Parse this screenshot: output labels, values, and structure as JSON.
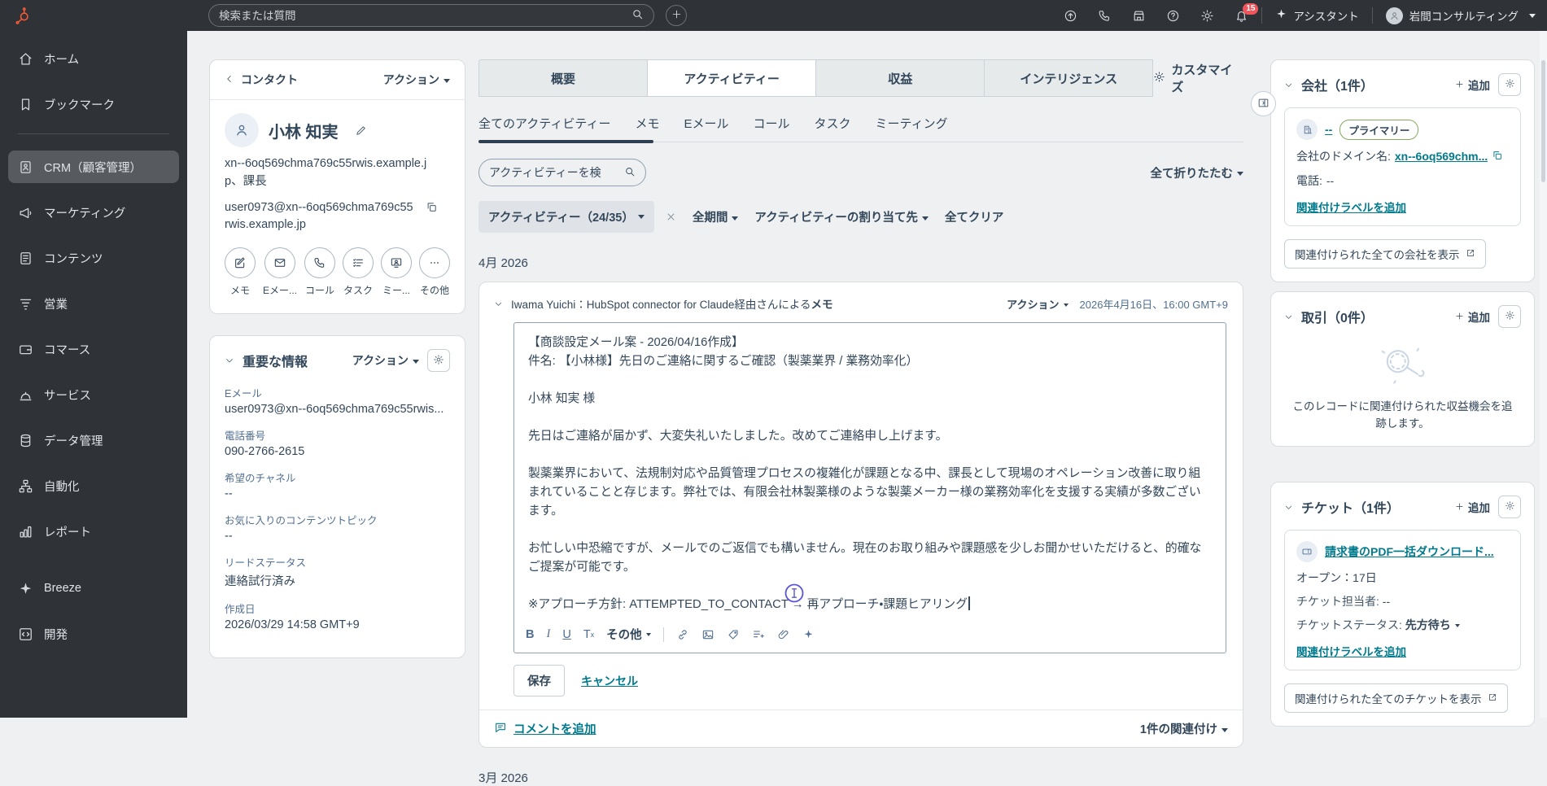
{
  "topbar": {
    "search_placeholder": "検索または質問",
    "assistant_label": "アシスタント",
    "account_name": "岩間コンサルティング",
    "notification_count": "15"
  },
  "sidebar": {
    "items": [
      {
        "label": "ホーム"
      },
      {
        "label": "ブックマーク"
      },
      {
        "label": "CRM（顧客管理）"
      },
      {
        "label": "マーケティング"
      },
      {
        "label": "コンテンツ"
      },
      {
        "label": "営業"
      },
      {
        "label": "コマース"
      },
      {
        "label": "サービス"
      },
      {
        "label": "データ管理"
      },
      {
        "label": "自動化"
      },
      {
        "label": "レポート"
      },
      {
        "label": "Breeze"
      },
      {
        "label": "開発"
      }
    ]
  },
  "contact": {
    "back_label": "コンタクト",
    "actions_label": "アクション",
    "name": "小林 知実",
    "title_line": "xn--6oq569chma769c55rwis.example.jp、課長",
    "email_line": "user0973@xn--6oq569chma769c55rwis.example.jp",
    "quick_actions": [
      "メモ",
      "Eメー...",
      "コール",
      "タスク",
      "ミー...",
      "その他"
    ],
    "about": {
      "title": "重要な情報",
      "actions_label": "アクション",
      "fields": [
        {
          "label": "Eメール",
          "value": "user0973@xn--6oq569chma769c55rwis..."
        },
        {
          "label": "電話番号",
          "value": "090-2766-2615"
        },
        {
          "label": "希望のチャネル",
          "value": "--"
        },
        {
          "label": "お気に入りのコンテンツトピック",
          "value": "--"
        },
        {
          "label": "リードステータス",
          "value": "連絡試行済み"
        },
        {
          "label": "作成日",
          "value": "2026/03/29 14:58 GMT+9"
        }
      ]
    }
  },
  "main": {
    "tabs": [
      "概要",
      "アクティビティー",
      "収益",
      "インテリジェンス"
    ],
    "customize_label": "カスタマイズ",
    "subtabs": [
      "全てのアクティビティー",
      "メモ",
      "Eメール",
      "コール",
      "タスク",
      "ミーティング"
    ],
    "search_placeholder": "アクティビティーを検",
    "collapse_all": "全て折りたたむ",
    "filter_chip": "アクティビティー（24/35）",
    "filter_period": "全期間",
    "filter_assignee": "アクティビティーの割り当て先",
    "clear_all": "全てクリア",
    "month_heading": "4月 2026",
    "next_month_heading": "3月 2026",
    "note": {
      "title": "Iwama Yuichi：HubSpot connector for Claude経由さんによる",
      "title_bold": "メモ",
      "actions_label": "アクション",
      "timestamp": "2026年4月16日、16:00 GMT+9",
      "paragraphs": [
        "【商談設定メール案 - 2026/04/16作成】",
        "件名: 【小林様】先日のご連絡に関するご確認（製薬業界 / 業務効率化）",
        "小林 知実 様",
        "先日はご連絡が届かず、大変失礼いたしました。改めてご連絡申し上げます。",
        "製薬業界において、法規制対応や品質管理プロセスの複雑化が課題となる中、課長として現場のオペレーション改善に取り組まれていることと存じます。弊社では、有限会社林製薬様のような製薬メーカー様の業務効率化を支援する実績が多数ございます。",
        "お忙しい中恐縮ですが、メールでのご返信でも構いません。現在のお取り組みや課題感を少しお聞かせいただけると、的確なご提案が可能です。",
        "※アプローチ方針: ATTEMPTED_TO_CONTACT → 再アプローチ・課題ヒアリング"
      ],
      "toolbar": {
        "bold": "B",
        "italic": "I",
        "underline": "U",
        "clear": "T",
        "clear_sub": "x",
        "more": "その他"
      },
      "save_label": "保存",
      "cancel_label": "キャンセル",
      "add_comment_label": "コメントを追加",
      "association_label": "1件の関連付け"
    }
  },
  "right": {
    "company": {
      "title": "会社（1件）",
      "add_label": "追加",
      "name_link": "--",
      "primary_badge": "プライマリー",
      "domain_label": "会社のドメイン名:",
      "domain_value": "xn--6oq569chm...",
      "phone_label": "電話:",
      "phone_value": "--",
      "add_assoc_label": "関連付けラベルを追加",
      "view_all": "関連付けられた全ての会社を表示"
    },
    "deals": {
      "title": "取引（0件）",
      "add_label": "追加",
      "empty_text": "このレコードに関連付けられた収益機会を追跡します。"
    },
    "tickets": {
      "title": "チケット（1件）",
      "add_label": "追加",
      "name_link": "請求書のPDF一括ダウンロード...",
      "open_line": "オープン：17日",
      "owner_label": "チケット担当者:",
      "owner_value": "--",
      "status_label": "チケットステータス:",
      "status_value": "先方待ち",
      "add_assoc_label": "関連付けラベルを追加",
      "view_all": "関連付けられた全てのチケットを表示"
    }
  },
  "colors": {
    "accent_orange": "#ff5c35",
    "link_teal": "#007a8c",
    "badge_red": "#f2545b"
  }
}
